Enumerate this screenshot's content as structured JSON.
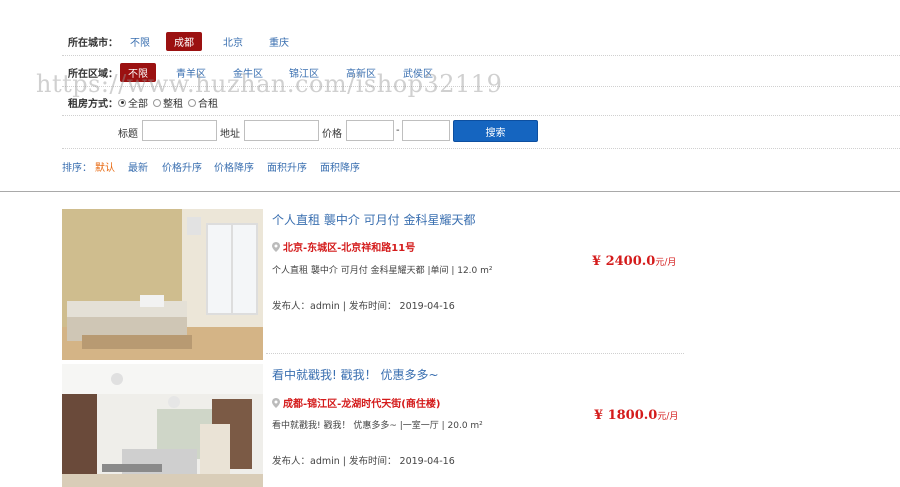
{
  "filters": {
    "city": {
      "label": "所在城市：",
      "options": [
        "不限",
        "成都",
        "北京",
        "重庆"
      ],
      "active": "成都"
    },
    "district": {
      "label": "所在区域：",
      "options": [
        "不限",
        "青羊区",
        "金牛区",
        "锦江区",
        "高新区",
        "武侯区"
      ],
      "active": "不限"
    },
    "rent_type": {
      "label": "租房方式：",
      "options": [
        "全部",
        "整租",
        "合租"
      ],
      "selected": "全部"
    }
  },
  "search": {
    "title_label": "标题",
    "address_label": "地址",
    "price_label": "价格",
    "price_sep": "-",
    "button_label": "搜索"
  },
  "sort": {
    "label": "排序：",
    "options": [
      "默认",
      "最新",
      "价格升序",
      "价格降序",
      "面积升序",
      "面积降序"
    ],
    "active": "默认"
  },
  "watermark": "https://www.huzhan.com/ishop32119",
  "listings": [
    {
      "title": "个人直租 襲中介 可月付 金科星耀天都",
      "address": "北京-东城区-北京祥和路11号",
      "desc": "个人直租 襲中介 可月付 金科星耀天都 |单间 | 12.0 m²",
      "meta": "发布人：admin | 发布时间： 2019-04-16",
      "price": "¥ 2400.0",
      "unit": "元/月"
    },
    {
      "title": "看中就戳我! 戳我！ 优惠多多~",
      "address": "成都-锦江区-龙湖时代天街(商住楼)",
      "desc": "看中就戳我! 戳我！ 优惠多多~ |一室一厅 | 20.0 m²",
      "meta": "发布人：admin | 发布时间： 2019-04-16",
      "price": "¥ 1800.0",
      "unit": "元/月"
    }
  ],
  "colors": {
    "active_bg": "#9b1111",
    "link": "#3a6fb0",
    "sort_active": "#e86a12",
    "price": "#d41b1b",
    "search_button": "#1565c0"
  }
}
